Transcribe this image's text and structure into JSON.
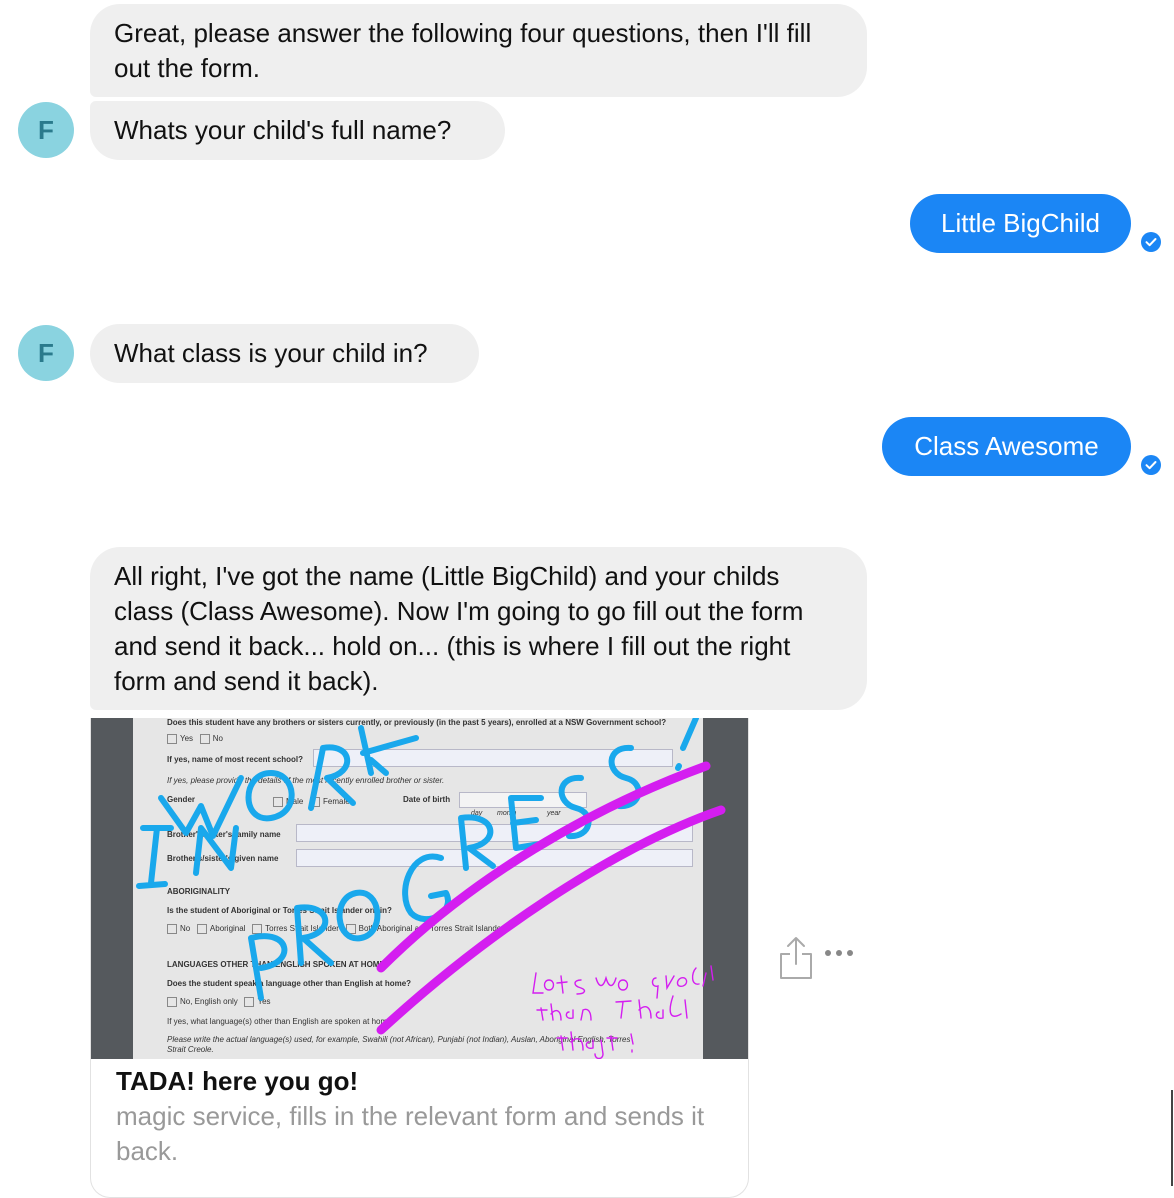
{
  "messages": {
    "bot_intro": "Great, please answer the following four questions, then I'll fill out the form.",
    "bot_q1": "Whats your child's full name?",
    "user_a1": "Little BigChild",
    "bot_q2": "What class is your child in?",
    "user_a2": "Class Awesome",
    "bot_summary": "All right, I've got the name (Little BigChild) and your childs class (Class Awesome). Now I'm going to go fill out the form and send it back... hold on... (this is where I fill out the right form and send it back)."
  },
  "avatar": {
    "letter": "F",
    "color": "#8ad3e0"
  },
  "colors": {
    "user_bubble": "#1b86f5",
    "bot_bubble": "#efefef",
    "scribble_blue": "#19a8ec",
    "scribble_magenta": "#d41ef0"
  },
  "card": {
    "title": "TADA! here you go!",
    "subtitle": "magic service, fills in the relevant form and sends it back.",
    "form": {
      "q_siblings": "Does this student have any brothers or sisters currently, or previously (in the past 5 years), enrolled at a NSW Government school?",
      "opt_yes": "Yes",
      "opt_no": "No",
      "school_label": "If yes, name of most recent school?",
      "sibling_note": "If yes, please provide the details of the most recently enrolled brother or sister.",
      "gender_label": "Gender",
      "opt_male": "Male",
      "opt_female": "Female",
      "dob_label": "Date of birth",
      "dob_day": "day",
      "dob_month": "month",
      "dob_year": "year",
      "family_name_label": "Brother's/sister's family name",
      "given_name_label": "Brother's/sister's given name",
      "aboriginality_heading": "ABORIGINALITY",
      "aboriginal_q": "Is the student of Aboriginal or Torres Strait Islander origin?",
      "opt_aboriginal": "Aboriginal",
      "opt_tsi": "Torres Strait Islander",
      "opt_both": "Both Aboriginal and Torres Strait Islander",
      "languages_heading": "LANGUAGES OTHER THAN ENGLISH SPOKEN AT HOME",
      "language_q": "Does the student speak a language other than English at home?",
      "opt_english_only": "No, English only",
      "language_which": "If yes, what language(s) other than English are spoken at home?",
      "language_note": "Please write the actual language(s) used, for example, Swahili (not African), Punjabi (not Indian), Auslan, Aboriginal English, Torres Strait Creole."
    },
    "scribble_main": "WORK IN PROGRESS!",
    "scribble_note": "lots more questions than I had thought!"
  },
  "icons": {
    "check": "check-circle-icon",
    "share": "share-icon",
    "more": "more-icon"
  }
}
